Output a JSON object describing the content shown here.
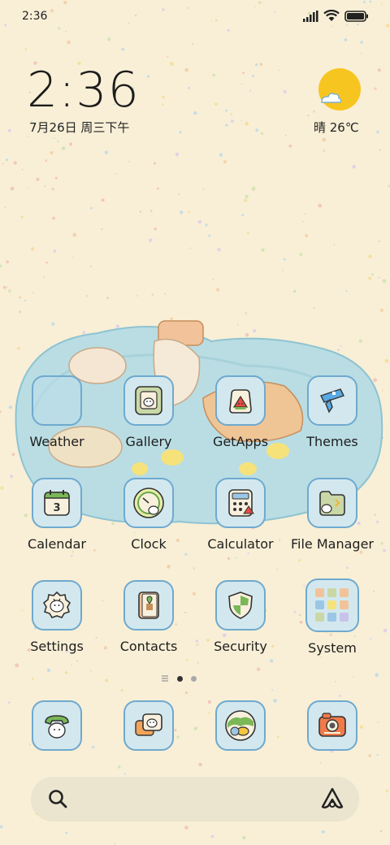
{
  "status_bar": {
    "time": "2:36",
    "icons": [
      "signal-icon",
      "wifi-icon",
      "battery-icon"
    ]
  },
  "clock_widget": {
    "time": "2:36",
    "date": "7月26日 周三下午"
  },
  "weather_widget": {
    "icon": "sun-cloud-icon",
    "text": "晴 26℃"
  },
  "apps": [
    {
      "label": "Weather",
      "icon": "weather-icon"
    },
    {
      "label": "Gallery",
      "icon": "gallery-icon"
    },
    {
      "label": "GetApps",
      "icon": "getapps-icon"
    },
    {
      "label": "Themes",
      "icon": "themes-icon"
    },
    {
      "label": "Calendar",
      "icon": "calendar-icon"
    },
    {
      "label": "Clock",
      "icon": "clock-icon"
    },
    {
      "label": "Calculator",
      "icon": "calculator-icon"
    },
    {
      "label": "File Manager",
      "icon": "file-manager-icon"
    },
    {
      "label": "Settings",
      "icon": "settings-icon"
    },
    {
      "label": "Contacts",
      "icon": "contacts-icon"
    },
    {
      "label": "Security",
      "icon": "security-icon"
    },
    {
      "label": "System",
      "icon": "folder-icon"
    }
  ],
  "calendar_day": "3",
  "page_indicator": {
    "pages": 2,
    "current": 1
  },
  "dock": [
    {
      "icon": "phone-icon"
    },
    {
      "icon": "messages-icon"
    },
    {
      "icon": "browser-icon"
    },
    {
      "icon": "camera-icon"
    }
  ],
  "search_bar": {
    "left_icon": "search-icon",
    "right_icon": "assistant-icon"
  },
  "colors": {
    "background": "#f8efd6",
    "tile": "#d3e8ee",
    "tile_border": "#6fa9cf",
    "sun": "#f7c51f"
  }
}
